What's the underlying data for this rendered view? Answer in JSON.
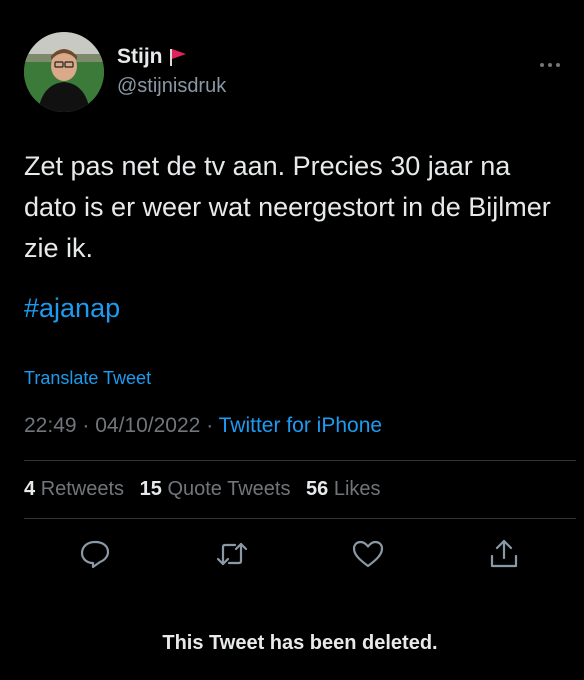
{
  "author": {
    "display_name": "Stijn",
    "handle": "@stijnisdruk",
    "flag_icon": "red-flag-icon"
  },
  "tweet": {
    "text": "Zet pas net de tv aan. Precies 30 jaar na dato is er weer wat neergestort in de Bijlmer zie ik.",
    "hashtag": "#ajanap",
    "translate_label": "Translate Tweet",
    "time": "22:49",
    "date": "04/10/2022",
    "source": "Twitter for iPhone"
  },
  "stats": {
    "retweets_count": "4",
    "retweets_label": "Retweets",
    "quotes_count": "15",
    "quotes_label": "Quote Tweets",
    "likes_count": "56",
    "likes_label": "Likes"
  },
  "actions": [
    "reply-icon",
    "retweet-icon",
    "like-icon",
    "share-icon"
  ],
  "notice": "This Tweet has been deleted.",
  "colors": {
    "background": "#000000",
    "text": "#e7e9ea",
    "secondary": "#71767b",
    "link": "#1d9bf0",
    "divider": "#2f3336"
  }
}
